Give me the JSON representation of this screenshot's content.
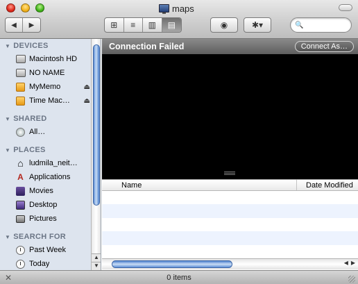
{
  "window": {
    "title": "maps"
  },
  "toolbar": {
    "back_glyph": "◀",
    "forward_glyph": "▶",
    "view_icon_glyph": "⊞",
    "view_list_glyph": "≡",
    "view_columns_glyph": "▥",
    "view_coverflow_glyph": "▤",
    "quicklook_glyph": "◉",
    "action_glyph": "✱▾",
    "search_glyph": "🔍",
    "search_value": "",
    "search_placeholder": ""
  },
  "sidebar": {
    "devices": {
      "header": "DEVICES",
      "items": [
        {
          "label": "Macintosh HD",
          "icon": "hard-drive-icon",
          "eject": false
        },
        {
          "label": "NO NAME",
          "icon": "hard-drive-icon",
          "eject": false
        },
        {
          "label": "MyMemo",
          "icon": "removable-disk-icon",
          "eject": true
        },
        {
          "label": "Time Mac…",
          "icon": "removable-disk-icon",
          "eject": true
        }
      ]
    },
    "shared": {
      "header": "SHARED",
      "items": [
        {
          "label": "All…",
          "icon": "network-icon"
        }
      ]
    },
    "places": {
      "header": "PLACES",
      "items": [
        {
          "label": "ludmila_neit…",
          "icon": "home-icon"
        },
        {
          "label": "Applications",
          "icon": "applications-icon"
        },
        {
          "label": "Movies",
          "icon": "movies-icon"
        },
        {
          "label": "Desktop",
          "icon": "desktop-icon"
        },
        {
          "label": "Pictures",
          "icon": "pictures-icon"
        }
      ]
    },
    "search_for": {
      "header": "SEARCH FOR",
      "items": [
        {
          "label": "Past Week",
          "icon": "clock-icon"
        },
        {
          "label": "Today",
          "icon": "clock-icon"
        }
      ]
    },
    "triangle_glyph": "▼",
    "eject_glyph": "⏏",
    "home_glyph": "⌂",
    "apps_glyph": "A"
  },
  "connection": {
    "message": "Connection Failed",
    "button_label": "Connect As…"
  },
  "columns": {
    "name": "Name",
    "date_modified": "Date Modified"
  },
  "status": {
    "items_text": "0 items",
    "tool_glyph": "✕"
  },
  "colors": {
    "sidebar_bg": "#dde4ee",
    "section_header": "#6b7585",
    "scroll_thumb": "#5d8fd6",
    "alt_row": "#edf3fe"
  }
}
